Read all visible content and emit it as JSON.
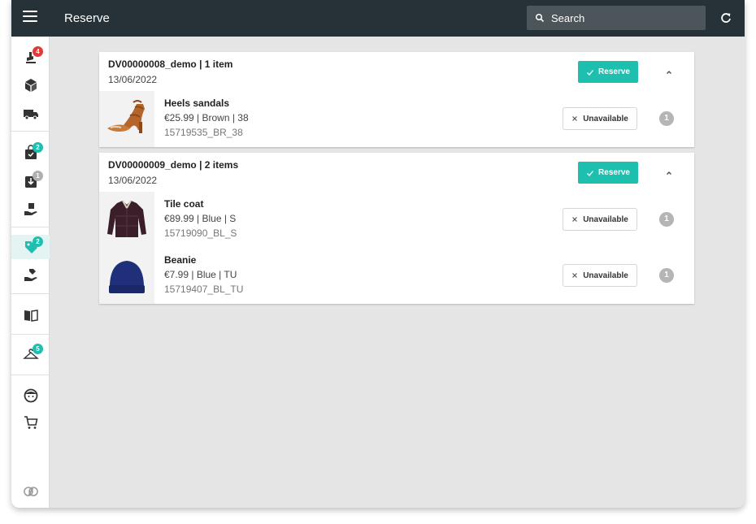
{
  "header": {
    "title": "Reserve",
    "search_placeholder": "Search",
    "menu_icon": "hamburger-icon",
    "refresh_icon": "refresh-icon"
  },
  "sidebar": {
    "items": [
      {
        "icon": "scanner-icon",
        "badge": "4",
        "badge_color": "#e53935"
      },
      {
        "icon": "package-icon",
        "badge": ""
      },
      {
        "icon": "truck-icon",
        "badge": ""
      },
      {
        "icon": "shopping-bag-icon",
        "badge": "2",
        "badge_color": "#1ebfaf"
      },
      {
        "icon": "inbox-download-icon",
        "badge": "1",
        "badge_color": "#b0b0b0"
      },
      {
        "icon": "hand-package-icon",
        "badge": ""
      },
      {
        "icon": "tag-icon",
        "badge": "2",
        "badge_color": "#1ebfaf",
        "active": true
      },
      {
        "icon": "hand-tag-icon",
        "badge": ""
      },
      {
        "icon": "book-map-icon",
        "badge": ""
      },
      {
        "icon": "hanger-icon",
        "badge": "5",
        "badge_color": "#1ebfaf"
      },
      {
        "icon": "face-icon",
        "badge": ""
      },
      {
        "icon": "cart-icon",
        "badge": ""
      },
      {
        "icon": "logo-icon",
        "badge": ""
      }
    ]
  },
  "orders": [
    {
      "title": "DV00000008_demo | 1 item",
      "date": "13/06/2022",
      "reserve_label": "Reserve",
      "items": [
        {
          "name": "Heels sandals",
          "meta": "€25.99 | Brown | 38",
          "sku": "15719535_BR_38",
          "unavailable_label": "Unavailable",
          "qty": "1",
          "thumb_icon": "sandal-image"
        }
      ]
    },
    {
      "title": "DV00000009_demo | 2 items",
      "date": "13/06/2022",
      "reserve_label": "Reserve",
      "items": [
        {
          "name": "Tile coat",
          "meta": "€89.99 | Blue | S",
          "sku": "15719090_BL_S",
          "unavailable_label": "Unavailable",
          "qty": "1",
          "thumb_icon": "coat-image"
        },
        {
          "name": "Beanie",
          "meta": "€7.99 | Blue | TU",
          "sku": "15719407_BL_TU",
          "unavailable_label": "Unavailable",
          "qty": "1",
          "thumb_icon": "beanie-image"
        }
      ]
    }
  ],
  "colors": {
    "topbar": "#263238",
    "accent": "#1ebfaf",
    "alert": "#e53935",
    "background": "#e5e5e5"
  }
}
